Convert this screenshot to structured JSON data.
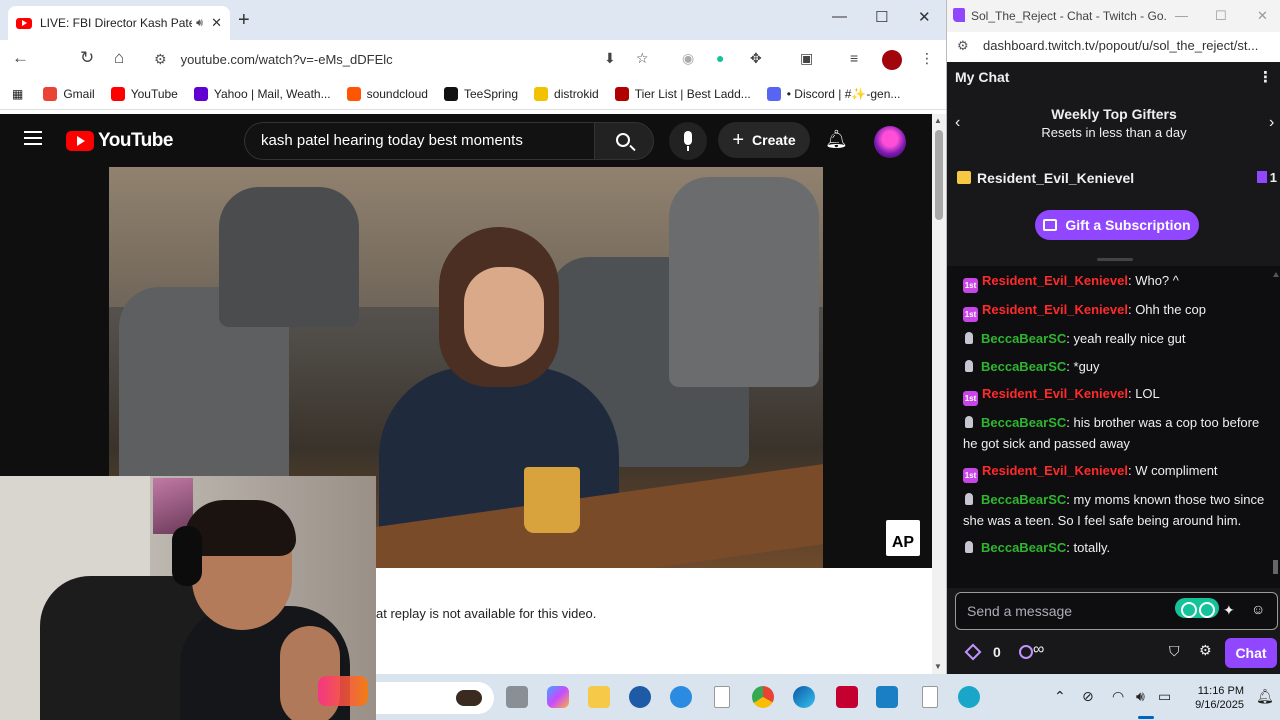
{
  "browser": {
    "tab_title": "LIVE: FBI Director Kash Patel",
    "url": "youtube.com/watch?v=-eMs_dDFElc",
    "bookmarks": [
      {
        "label": "Gmail",
        "color": "#ea4335"
      },
      {
        "label": "YouTube",
        "color": "#ff0000"
      },
      {
        "label": "Yahoo | Mail, Weath...",
        "color": "#6001d2"
      },
      {
        "label": "soundcloud",
        "color": "#ff5500"
      },
      {
        "label": "TeeSpring",
        "color": "#111111"
      },
      {
        "label": "distrokid",
        "color": "#f2c200"
      },
      {
        "label": "Tier List | Best Ladd...",
        "color": "#b00000"
      },
      {
        "label": "• Discord | #✨-gen...",
        "color": "#5865f2"
      }
    ]
  },
  "youtube": {
    "logo_text": "YouTube",
    "search_query": "kash patel hearing today best moments",
    "create_label": "Create",
    "video_watermark": "AP",
    "chat_replay_text": "at replay is not available for this video."
  },
  "twitch": {
    "window_title": "Sol_The_Reject - Chat - Twitch - Go...",
    "url": "dashboard.twitch.tv/popout/u/sol_the_reject/st...",
    "header": "My Chat",
    "gifters_title": "Weekly Top Gifters",
    "gifters_subtitle": "Resets in less than a day",
    "top_gifter": "Resident_Evil_Kenievel",
    "top_gifter_count": "1",
    "gift_button": "Gift a Subscription",
    "messages": [
      {
        "user": "Resident_Evil_Kenievel",
        "color": "red",
        "text": ": Who? ^"
      },
      {
        "user": "Resident_Evil_Kenievel",
        "color": "red",
        "text": ": Ohh the cop"
      },
      {
        "user": "BeccaBearSC",
        "color": "green",
        "text": ": yeah really nice gut"
      },
      {
        "user": "BeccaBearSC",
        "color": "green",
        "text": ": *guy"
      },
      {
        "user": "Resident_Evil_Kenievel",
        "color": "red",
        "text": ": LOL"
      },
      {
        "user": "BeccaBearSC",
        "color": "green",
        "text": ": his brother was a cop too before he got sick and passed away"
      },
      {
        "user": "Resident_Evil_Kenievel",
        "color": "red",
        "text": ": W compliment"
      },
      {
        "user": "BeccaBearSC",
        "color": "green",
        "text": ": my moms known those two since she was a teen. So I feel safe being around him."
      },
      {
        "user": "BeccaBearSC",
        "color": "green",
        "text": ": totally."
      }
    ],
    "input_placeholder": "Send a message",
    "points_value": "0",
    "infinity": "∞",
    "chat_button": "Chat"
  },
  "taskbar": {
    "time": "11:16 PM",
    "date": "9/16/2025"
  }
}
